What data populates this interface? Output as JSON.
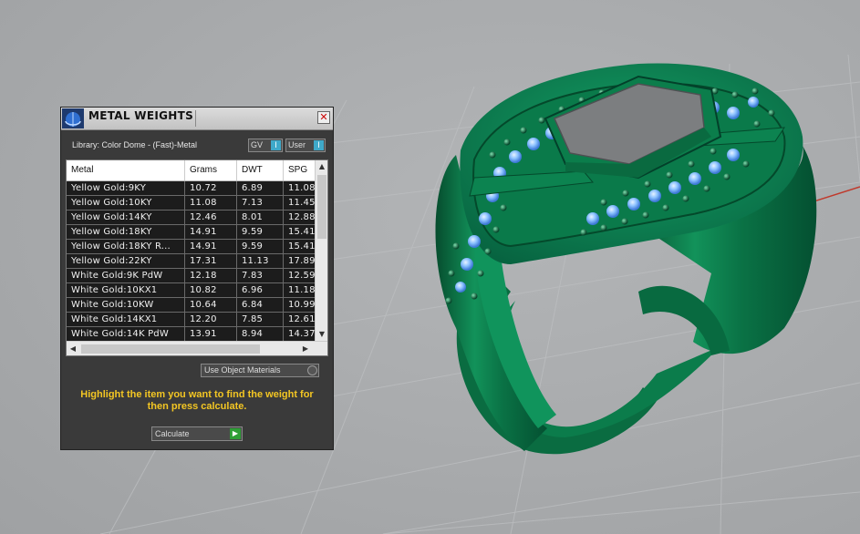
{
  "panel": {
    "title": "METAL WEIGHTS",
    "close_glyph": "✕",
    "library_label": "Library: Color Dome - (Fast)-Metal",
    "toggles": [
      {
        "label": "GV",
        "knob": "I"
      },
      {
        "label": "User",
        "knob": "I"
      }
    ],
    "table": {
      "columns": [
        "Metal",
        "Grams",
        "DWT",
        "SPG"
      ],
      "rows": [
        [
          "Yellow Gold:9KY",
          "10.72",
          "6.89",
          "11.08"
        ],
        [
          "Yellow Gold:10KY",
          "11.08",
          "7.13",
          "11.45"
        ],
        [
          "Yellow Gold:14KY",
          "12.46",
          "8.01",
          "12.88"
        ],
        [
          "Yellow Gold:18KY",
          "14.91",
          "9.59",
          "15.41"
        ],
        [
          "Yellow Gold:18KY R...",
          "14.91",
          "9.59",
          "15.41"
        ],
        [
          "Yellow Gold:22KY",
          "17.31",
          "11.13",
          "17.89"
        ],
        [
          "White Gold:9K PdW",
          "12.18",
          "7.83",
          "12.59"
        ],
        [
          "White Gold:10KX1",
          "10.82",
          "6.96",
          "11.18"
        ],
        [
          "White Gold:10KW",
          "10.64",
          "6.84",
          "10.99"
        ],
        [
          "White Gold:14KX1",
          "12.20",
          "7.85",
          "12.61"
        ],
        [
          "White Gold:14K PdW",
          "13.91",
          "8.94",
          "14.37"
        ]
      ]
    },
    "use_object_materials": "Use Object Materials",
    "instruction": "Highlight the item you want to find the weight for then press calculate.",
    "calculate_label": "Calculate"
  },
  "icons": {
    "logo": "color-dome-logo-icon",
    "close": "close-icon",
    "calculate": "play-icon"
  },
  "colors": {
    "ring": "#0d7a4a",
    "stone_blue": "#7fb9ff",
    "instruction": "#f3c623",
    "accent": "#3fa9c9"
  }
}
